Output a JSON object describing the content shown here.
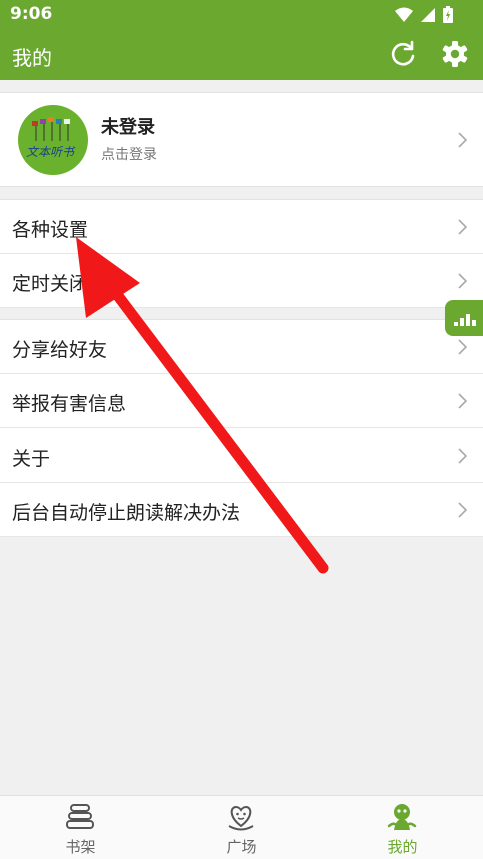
{
  "status_bar": {
    "time": "9:06"
  },
  "app_bar": {
    "title": "我的",
    "refresh_icon": "refresh-icon",
    "settings_icon": "gear-icon"
  },
  "profile": {
    "name": "未登录",
    "subtitle": "点击登录",
    "logo_text": "文本听书"
  },
  "menu_group_1": [
    {
      "label": "各种设置"
    },
    {
      "label": "定时关闭"
    }
  ],
  "menu_group_2": [
    {
      "label": "分享给好友"
    },
    {
      "label": "举报有害信息"
    },
    {
      "label": "关于"
    },
    {
      "label": "后台自动停止朗读解决办法"
    }
  ],
  "bottom_nav": [
    {
      "label": "书架",
      "icon": "bookshelf-icon",
      "active": false
    },
    {
      "label": "广场",
      "icon": "plaza-heart-icon",
      "active": false
    },
    {
      "label": "我的",
      "icon": "profile-mascot-icon",
      "active": true
    }
  ],
  "colors": {
    "primary": "#6aa82f",
    "annotation_arrow": "#f01818"
  }
}
